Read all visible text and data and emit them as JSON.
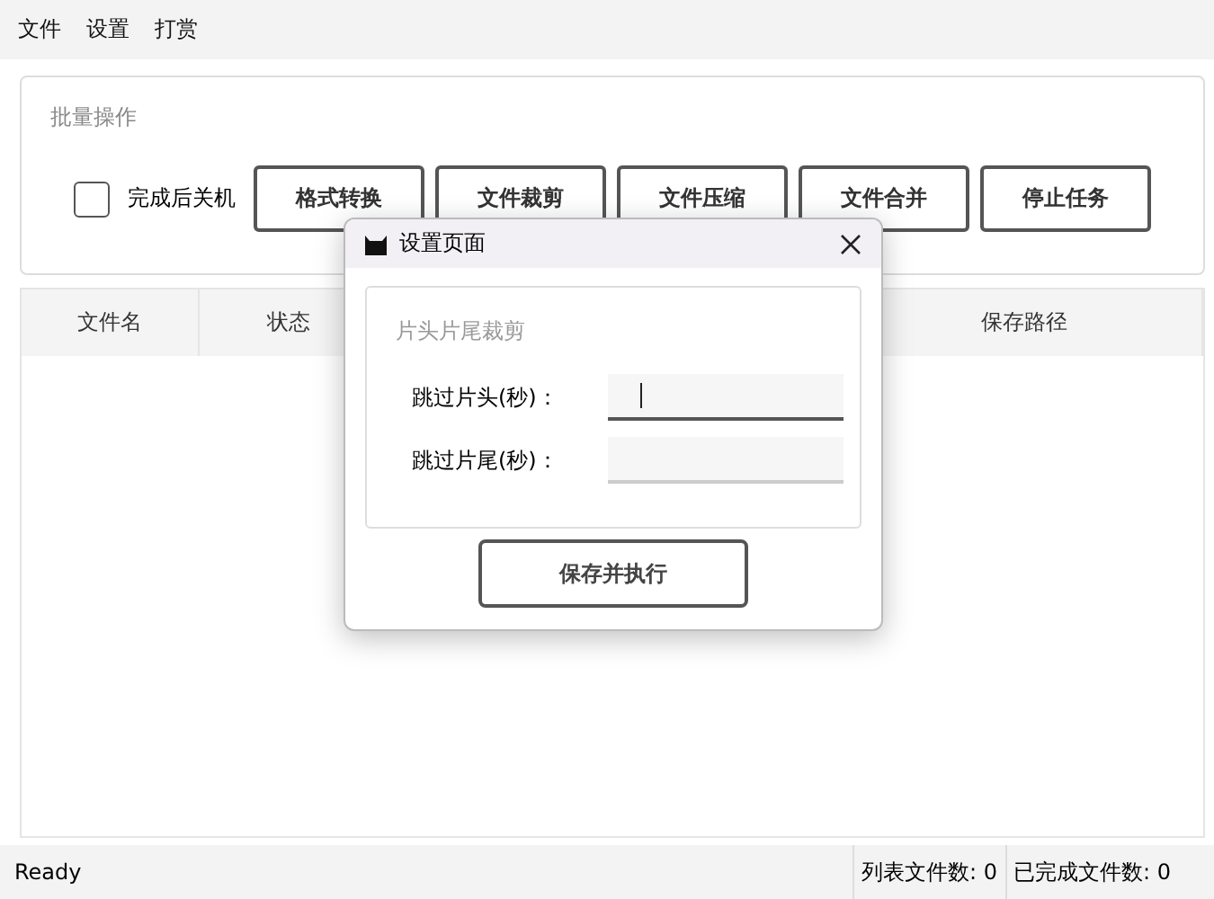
{
  "menu": [
    "文件",
    "设置",
    "打赏"
  ],
  "batch": {
    "title": "批量操作",
    "shutdown": {
      "label": "完成后关机",
      "checked": false
    },
    "buttons": [
      "格式转换",
      "文件裁剪",
      "文件压缩",
      "文件合并",
      "停止任务"
    ]
  },
  "table": {
    "columns": [
      "文件名",
      "状态",
      null,
      "保存路径"
    ]
  },
  "status_bar": {
    "message": "Ready",
    "list_count": "列表文件数: 0",
    "done_count": "已完成文件数: 0"
  },
  "dialog": {
    "title": "设置页面",
    "group": "片头片尾裁剪",
    "fields": [
      {
        "label": "跳过片头(秒)：",
        "focused": true
      },
      {
        "label": "跳过片尾(秒)：",
        "focused": false
      }
    ],
    "button": "保存并执行"
  }
}
